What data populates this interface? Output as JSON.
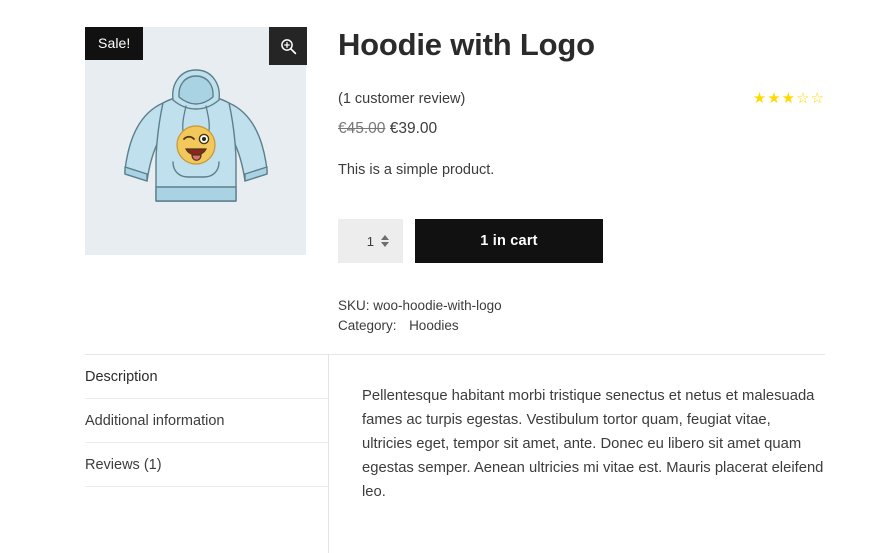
{
  "gallery": {
    "sale_badge": "Sale!",
    "zoom_icon": "magnifier-zoom-in-icon",
    "image_alt": "Light blue hoodie with yellow winking emoji logo",
    "background_color": "#e8edf1",
    "hoodie_color": "#bfe0ec",
    "emoji_color": "#f2c75c"
  },
  "product": {
    "title": "Hoodie with Logo",
    "review_link": "(1 customer review)",
    "rating": {
      "value": 3,
      "max": 5,
      "filled_glyph": "★",
      "empty_glyph": "☆",
      "color": "#ffd900"
    },
    "price": {
      "old": "€45.00",
      "new": "€39.00"
    },
    "short_description": "This is a simple product.",
    "quantity": {
      "value": "1",
      "placeholder": "1"
    },
    "add_to_cart_label": "1 in cart",
    "meta": {
      "sku_label": "SKU:",
      "sku_value": "woo-hoodie-with-logo",
      "category_label": "Category:",
      "category_value": "Hoodies"
    }
  },
  "tabs": {
    "items": [
      {
        "label": "Description",
        "active": true
      },
      {
        "label": "Additional information",
        "active": false
      },
      {
        "label": "Reviews (1)",
        "active": false
      }
    ],
    "panel": {
      "paragraph": "Pellentesque habitant morbi tristique senectus et netus et malesuada fames ac turpis egestas. Vestibulum tortor quam, feugiat vitae, ultricies eget, tempor sit amet, ante. Donec eu libero sit amet quam egestas semper. Aenean ultricies mi vitae est. Mauris placerat eleifend leo."
    }
  },
  "colors": {
    "accent_dark": "#111111",
    "text": "#3c3c3c",
    "star": "#ffd900",
    "muted": "#77787a"
  }
}
